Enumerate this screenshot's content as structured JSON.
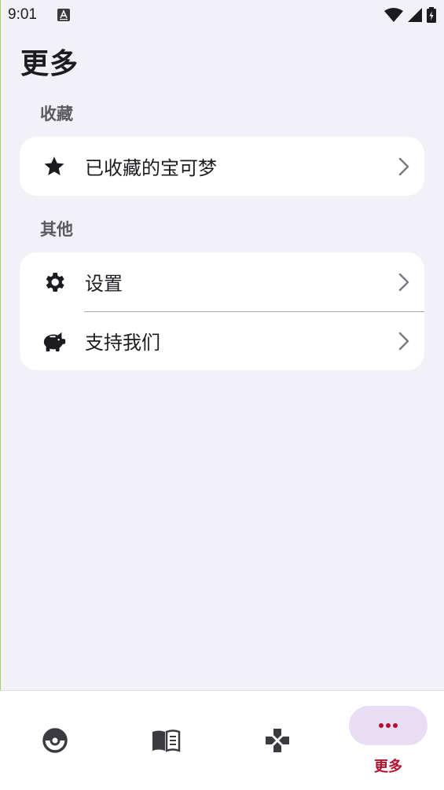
{
  "status_bar": {
    "time": "9:01",
    "notification_icon": "text-format-icon",
    "system_icons": [
      "wifi-icon",
      "cell-signal-icon",
      "battery-charging-icon"
    ]
  },
  "page": {
    "title": "更多"
  },
  "sections": [
    {
      "label": "收藏",
      "items": [
        {
          "label": "已收藏的宝可梦",
          "icon": "star-icon"
        }
      ]
    },
    {
      "label": "其他",
      "items": [
        {
          "label": "设置",
          "icon": "gear-icon"
        },
        {
          "label": "支持我们",
          "icon": "piggy-bank-icon"
        }
      ]
    }
  ],
  "bottom_nav": {
    "items": [
      {
        "icon": "pokeball-icon",
        "label": ""
      },
      {
        "icon": "book-icon",
        "label": ""
      },
      {
        "icon": "gamepad-icon",
        "label": ""
      },
      {
        "icon": "more-horizontal-icon",
        "label": "更多",
        "selected": true
      }
    ]
  },
  "colors": {
    "background": "#f2f1f7",
    "card": "#ffffff",
    "accent": "#b3102e",
    "active_pill": "#e9ddf5"
  }
}
